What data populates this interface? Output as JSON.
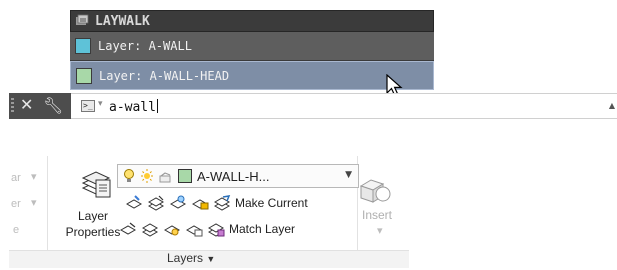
{
  "popup": {
    "header": "LAYWALK",
    "items": [
      {
        "label": "Layer: A-WALL",
        "swatch": "#5ec2d8"
      },
      {
        "label": "Layer: A-WALL-HEAD",
        "swatch": "#a8d8a8"
      }
    ]
  },
  "cmdline": {
    "input_value": "a-wall",
    "prompt_glyph": ">_"
  },
  "ribbon": {
    "ghost_labels": [
      "ar",
      "er",
      "e"
    ],
    "layer_properties_label_1": "Layer",
    "layer_properties_label_2": "Properties",
    "current_layer": "A-WALL-H...",
    "current_layer_color": "#a8d8a8",
    "make_current_label": "Make Current",
    "match_layer_label": "Match Layer",
    "panel_title": "Layers",
    "insert_label": "Insert"
  },
  "colors": {
    "popup_header_bg": "#3b3b3b",
    "popup_row_bg": "#5e5e5e",
    "popup_selected_bg": "#7e8ea6",
    "cmd_dark_bg": "#4d4d4d"
  }
}
